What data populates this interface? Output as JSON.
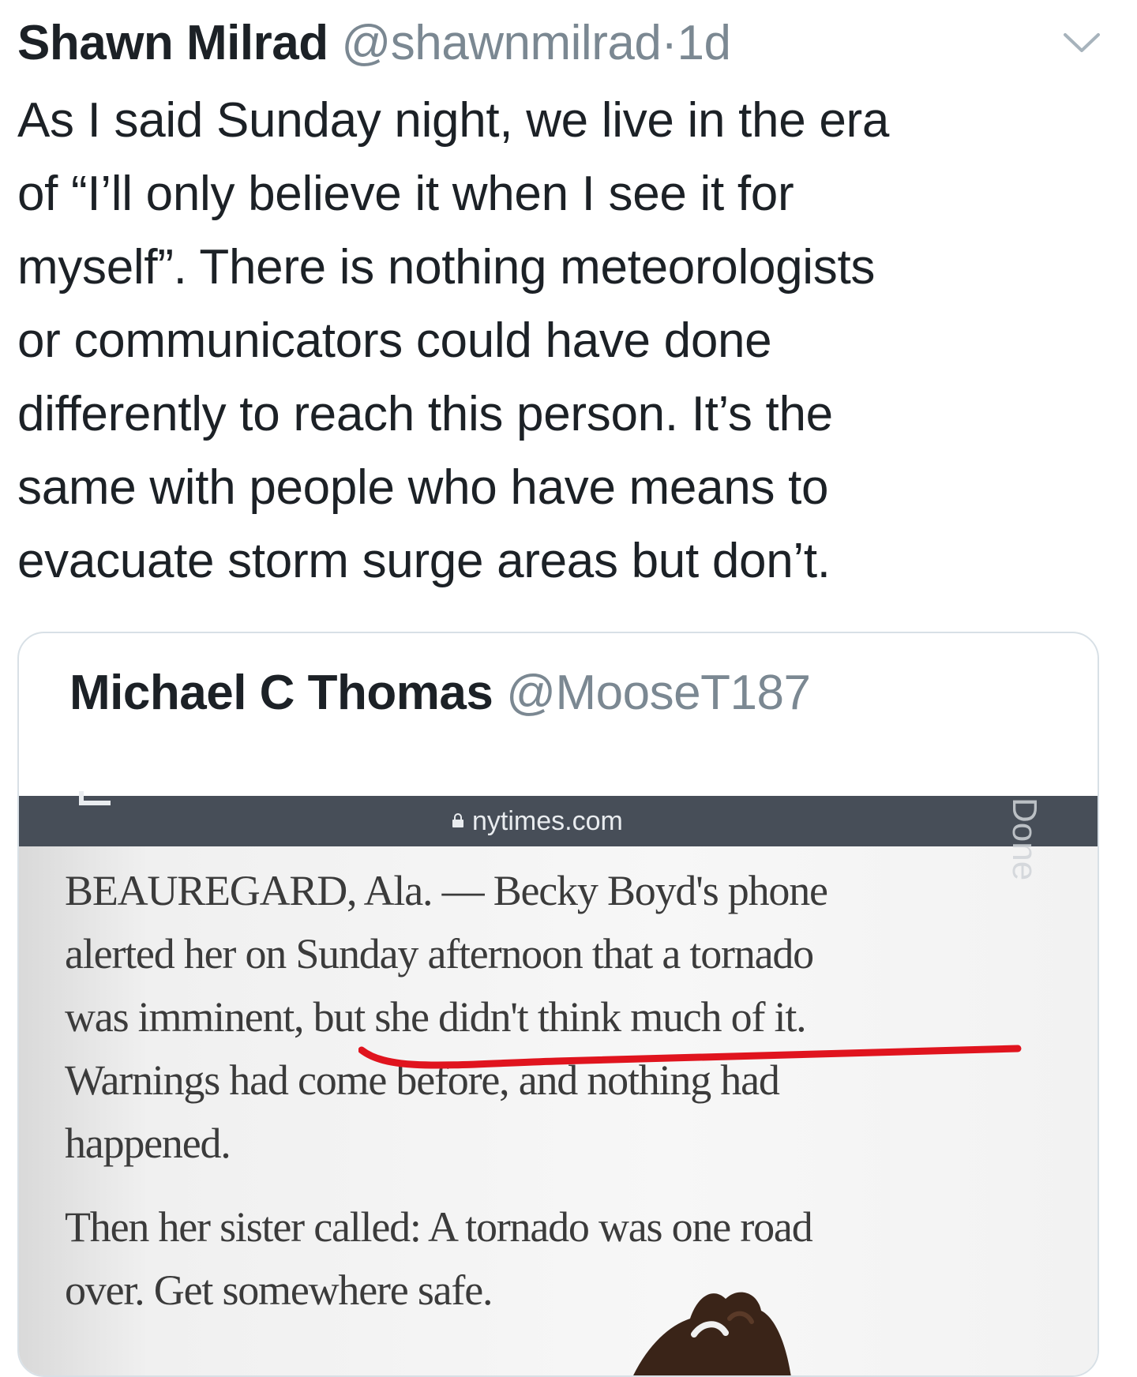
{
  "tweet": {
    "author_name": "Shawn Milrad",
    "author_handle": "@shawnmilrad",
    "separator": "·",
    "timestamp": "1d",
    "more_icon": "chevron-down-icon",
    "text_lines": [
      "As I said Sunday night, we live in the era",
      "of “I’ll only believe it when I see it for",
      "myself”. There is nothing meteorologists",
      "or communicators could have done",
      "differently to reach this person. It’s the",
      "same with people who have means to",
      "evacuate storm surge areas but don’t."
    ]
  },
  "quoted_tweet": {
    "author_name": "Michael C Thomas",
    "author_handle": "@MooseT187",
    "screenshot": {
      "browser": {
        "url": "nytimes.com",
        "lock_icon": "lock-icon",
        "done_label": "Done"
      },
      "article": {
        "paragraph1_lines": [
          "BEAUREGARD, Ala. — Becky Boyd's phone",
          "alerted her on Sunday afternoon that a tornado",
          "was imminent, but she didn't think much of it.",
          "Warnings had come before, and nothing had",
          "happened."
        ],
        "paragraph2_lines": [
          "Then her sister called: A tornado was one road",
          "over. Get somewhere safe."
        ],
        "highlight_color": "#e0141e"
      }
    }
  },
  "colors": {
    "text_primary": "#1c2126",
    "text_secondary": "#7b8892",
    "card_border": "#d8e0e6",
    "browser_bar": "#474e58"
  }
}
